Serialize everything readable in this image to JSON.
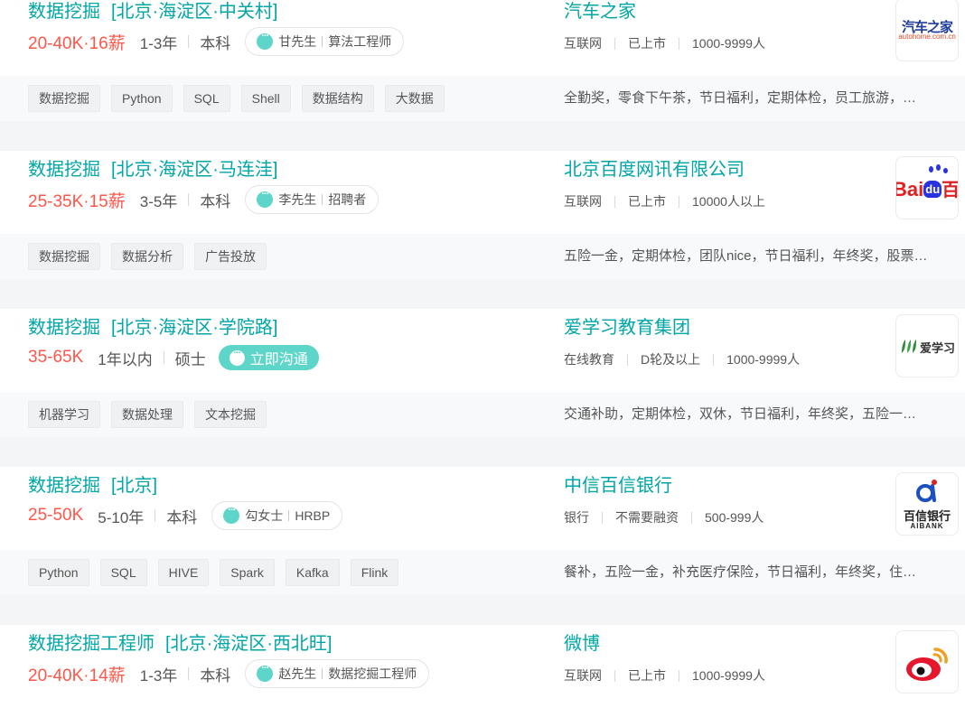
{
  "jobs": [
    {
      "title": "数据挖掘",
      "area": "[北京·海淀区·中关村]",
      "salary": "20-40K·16薪",
      "experience": "1-3年",
      "degree": "本科",
      "recruiter": {
        "name": "甘先生",
        "role": "算法工程师"
      },
      "company": "汽车之家",
      "company_tags": [
        "互联网",
        "已上市",
        "1000-9999人"
      ],
      "skills": [
        "数据挖掘",
        "Python",
        "SQL",
        "Shell",
        "数据结构",
        "大数据"
      ],
      "welfare": "全勤奖，零食下午茶，节日福利，定期体检，员工旅游，…",
      "logo": {
        "main": "汽车之家",
        "sub": "autohome.com.cn"
      }
    },
    {
      "title": "数据挖掘",
      "area": "[北京·海淀区·马连洼]",
      "salary": "25-35K·15薪",
      "experience": "3-5年",
      "degree": "本科",
      "recruiter": {
        "name": "李先生",
        "role": "招聘者"
      },
      "company": "北京百度网讯有限公司",
      "company_tags": [
        "互联网",
        "已上市",
        "10000人以上"
      ],
      "skills": [
        "数据挖掘",
        "数据分析",
        "广告投放"
      ],
      "welfare": "五险一金，定期体检，团队nice，节日福利，年终奖，股票…",
      "logo": {
        "main": "Bai",
        "paw": "du",
        "tail": "百"
      }
    },
    {
      "title": "数据挖掘",
      "area": "[北京·海淀区·学院路]",
      "salary": "35-65K",
      "experience": "1年以内",
      "degree": "硕士",
      "chat_button": "立即沟通",
      "company": "爱学习教育集团",
      "company_tags": [
        "在线教育",
        "D轮及以上",
        "1000-9999人"
      ],
      "skills": [
        "机器学习",
        "数据处理",
        "文本挖掘"
      ],
      "welfare": "交通补助，定期体检，双休，节日福利，年终奖，五险一…",
      "logo": {
        "main": "爱学习"
      }
    },
    {
      "title": "数据挖掘",
      "area": "[北京]",
      "salary": "25-50K",
      "experience": "5-10年",
      "degree": "本科",
      "recruiter": {
        "name": "勾女士",
        "role": "HRBP"
      },
      "company": "中信百信银行",
      "company_tags": [
        "银行",
        "不需要融资",
        "500-999人"
      ],
      "skills": [
        "Python",
        "SQL",
        "HIVE",
        "Spark",
        "Kafka",
        "Flink"
      ],
      "welfare": "餐补，五险一金，补充医疗保险，节日福利，年终奖，住…",
      "logo": {
        "main": "百信银行",
        "sub": "AIBANK"
      }
    },
    {
      "title": "数据挖掘工程师",
      "area": "[北京·海淀区·西北旺]",
      "salary": "20-40K·14薪",
      "experience": "1-3年",
      "degree": "本科",
      "recruiter": {
        "name": "赵先生",
        "role": "数据挖掘工程师"
      },
      "company": "微博",
      "company_tags": [
        "互联网",
        "已上市",
        "1000-9999人"
      ],
      "skills": [],
      "welfare": "",
      "logo": {}
    }
  ],
  "colors": {
    "accent": "#00a6a7",
    "salary": "#fe574a",
    "chat": "#5dd5c8"
  }
}
